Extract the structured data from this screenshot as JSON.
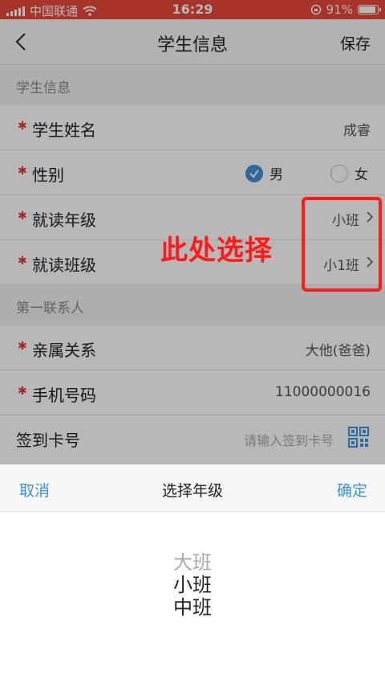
{
  "status_bar": {
    "carrier": "中国联通",
    "time": "16:29",
    "battery": "91%",
    "battery_level": 0.91
  },
  "nav": {
    "title": "学生信息",
    "save": "保存"
  },
  "student_section": {
    "header": "学生信息",
    "name": {
      "label": "学生姓名",
      "value": "成睿"
    },
    "gender": {
      "label": "性别",
      "male": "男",
      "female": "女",
      "selected": "男"
    },
    "grade": {
      "label": "就读年级",
      "value": "小班"
    },
    "class": {
      "label": "就读班级",
      "value": "小1班"
    }
  },
  "contact_section": {
    "header": "第一联系人",
    "relation": {
      "label": "亲属关系",
      "value": "大他(爸爸)"
    },
    "phone": {
      "label": "手机号码",
      "value": "11000000016"
    }
  },
  "card": {
    "label": "签到卡号",
    "placeholder": "请输入签到卡号"
  },
  "annotation": {
    "text": "此处选择",
    "color": "#ff1a1a"
  },
  "picker_sheet": {
    "cancel": "取消",
    "title": "选择年级",
    "confirm": "确定",
    "options": [
      "大班",
      "小班",
      "中班"
    ]
  },
  "colors": {
    "accent": "#3d92d9",
    "status_bar": "#e8483a",
    "required_star": "#e53935"
  },
  "icons": {
    "back": "chevron-left-icon",
    "qr": "qr-code-icon",
    "wifi": "wifi-icon"
  }
}
